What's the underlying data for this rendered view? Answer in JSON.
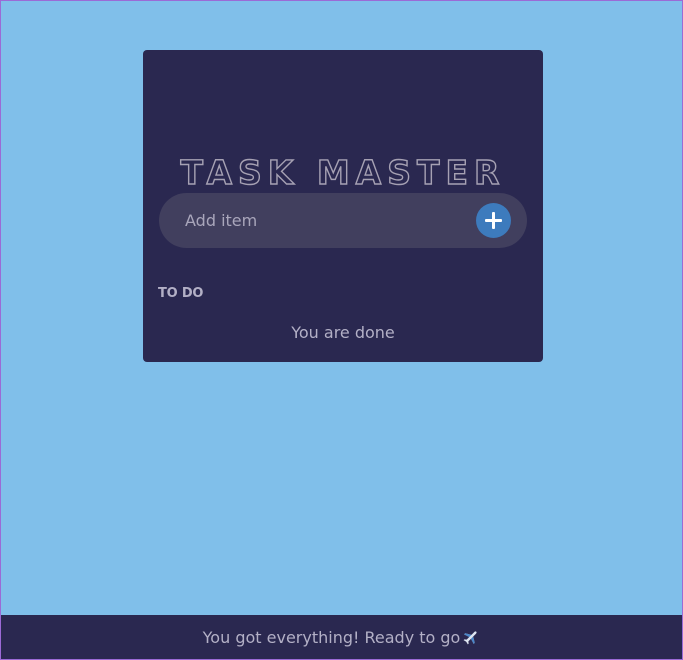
{
  "app": {
    "title": "TASK MASTER"
  },
  "add_item": {
    "placeholder": "Add item",
    "value": "",
    "button_icon": "plus-icon"
  },
  "todo": {
    "section_label": "TO DO",
    "empty_message": "You are done"
  },
  "footer": {
    "message": "You got everything! Ready to go",
    "icon": "airplane-icon"
  },
  "colors": {
    "page_background": "#80bfea",
    "card_background": "#2a2850",
    "input_background": "#413f5e",
    "accent": "#3d7bbd",
    "muted_text": "#b3b0c6"
  }
}
